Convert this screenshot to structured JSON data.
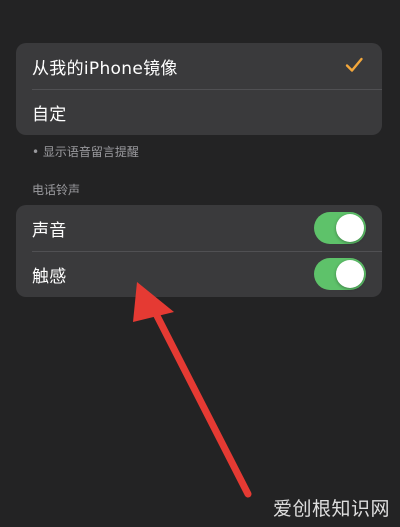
{
  "vibration_options": {
    "items": [
      {
        "label": "从我的iPhone镜像",
        "selected": true
      },
      {
        "label": "自定",
        "selected": false
      }
    ],
    "footnote": "• 显示语音留言提醒"
  },
  "ringer": {
    "header": "电话铃声",
    "items": [
      {
        "label": "声音",
        "on": true
      },
      {
        "label": "触感",
        "on": true
      }
    ]
  },
  "colors": {
    "accent": "#f3a73b",
    "toggle_on": "#5ec26a",
    "arrow": "#e53a33"
  },
  "watermark": "爱创根知识网"
}
